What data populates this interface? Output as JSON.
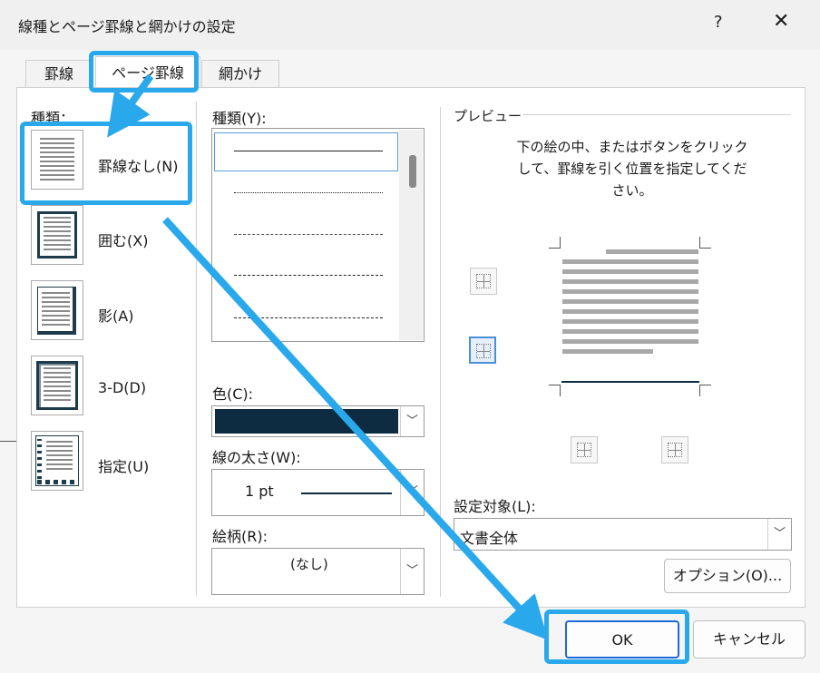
{
  "dialog": {
    "title": "線種とページ罫線と網かけの設定",
    "help": "?",
    "close": "✕"
  },
  "tabs": [
    {
      "label": "罫線"
    },
    {
      "label": "ページ罫線"
    },
    {
      "label": "網かけ"
    }
  ],
  "settings": {
    "header": "種類：",
    "items": [
      {
        "label": "罫線なし(N)"
      },
      {
        "label": "囲む(X)"
      },
      {
        "label": "影(A)"
      },
      {
        "label": "3-D(D)"
      },
      {
        "label": "指定(U)"
      }
    ]
  },
  "style": {
    "label": "種類(Y):",
    "color_label": "色(C):",
    "color_value": "#0d2c41",
    "width_label": "線の太さ(W):",
    "width_value": "1 pt",
    "art_label": "絵柄(R):",
    "art_value": "(なし)"
  },
  "preview": {
    "label": "プレビュー",
    "instruction": "下の絵の中、またはボタンをクリックして、罫線を引く位置を指定してください。",
    "apply_label": "設定対象(L):",
    "apply_value": "文書全体",
    "options_button": "オプション(O)..."
  },
  "footer": {
    "ok": "OK",
    "cancel": "キャンセル"
  },
  "colors": {
    "highlight": "#29a8ec",
    "accent": "#4a8fd9"
  }
}
